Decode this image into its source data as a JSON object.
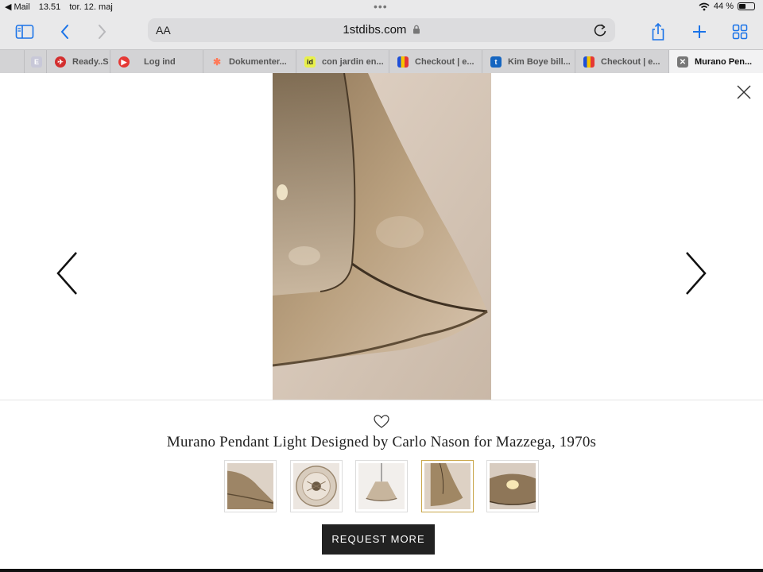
{
  "status_bar": {
    "back_app": "◀ Mail",
    "time": "13.51",
    "date": "tor. 12. maj",
    "battery": "44 %"
  },
  "toolbar": {
    "font_size_label": "AA",
    "url": "1stdibs.com"
  },
  "tabs": [
    {
      "label": "",
      "favicon": "E"
    },
    {
      "label": "Ready..S",
      "favicon": "plane"
    },
    {
      "label": "Log ind",
      "favicon": "play"
    },
    {
      "label": "Dokumenter...",
      "favicon": "hubspot"
    },
    {
      "label": "con jardin en...",
      "favicon": "id"
    },
    {
      "label": "Checkout | e...",
      "favicon": "bag"
    },
    {
      "label": "Kim Boye bill...",
      "favicon": "t"
    },
    {
      "label": "Checkout | e...",
      "favicon": "bag"
    },
    {
      "label": "Murano Pen...",
      "favicon": "close",
      "active": true
    }
  ],
  "product": {
    "title": "Murano Pendant Light Designed by Carlo Nason for Mazzega, 1970s",
    "request_button": "REQUEST MORE",
    "thumbnails": [
      {
        "name": "thumb-1",
        "selected": false
      },
      {
        "name": "thumb-2",
        "selected": false
      },
      {
        "name": "thumb-3",
        "selected": false
      },
      {
        "name": "thumb-4",
        "selected": true
      },
      {
        "name": "thumb-5",
        "selected": false
      }
    ]
  },
  "colors": {
    "accent": "#1a73e8",
    "button_bg": "#222222",
    "selected_border": "#c9a64a"
  }
}
